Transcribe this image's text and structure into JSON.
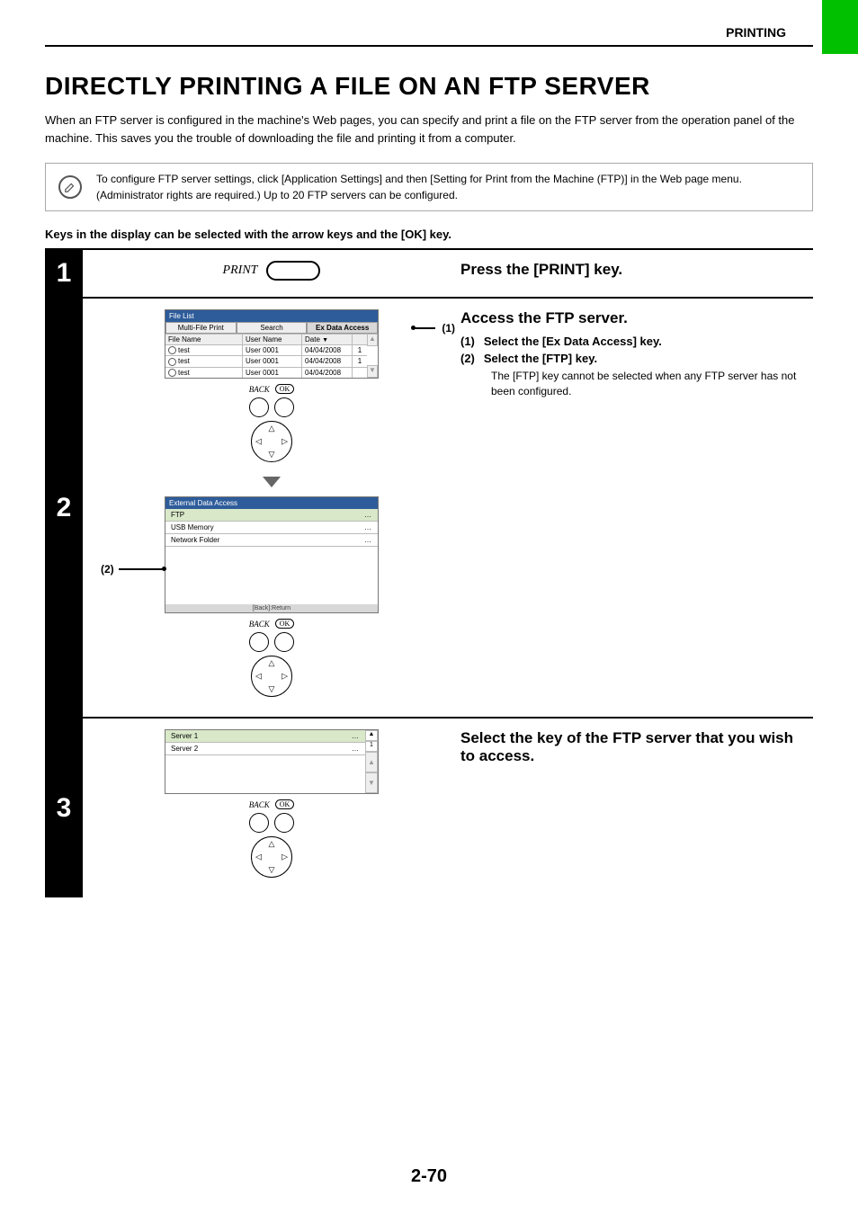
{
  "header": {
    "section": "PRINTING"
  },
  "title": "DIRECTLY PRINTING A FILE ON AN FTP SERVER",
  "intro": "When an FTP server is configured in the machine's Web pages, you can specify and print a file on the FTP server from the operation panel of the machine. This saves you the trouble of downloading the file and printing it from a computer.",
  "note": "To configure FTP server settings, click [Application Settings] and then [Setting for Print from the Machine (FTP)] in the Web page menu. (Administrator rights are required.) Up to 20 FTP servers can be configured.",
  "keys_note": "Keys in the display can be selected with the arrow keys and the [OK] key.",
  "steps": {
    "s1": {
      "num": "1",
      "print_label": "PRINT",
      "title": "Press the [PRINT] key."
    },
    "s2": {
      "num": "2",
      "title": "Access the FTP server.",
      "sub1_num": "(1)",
      "sub1_text": "Select the [Ex Data Access] key.",
      "sub2_num": "(2)",
      "sub2_text": "Select the [FTP] key.",
      "sub2_desc": "The [FTP] key cannot be selected when any FTP server has not been configured.",
      "callout1": "(1)",
      "callout2": "(2)",
      "screen1": {
        "title": "File List",
        "tab1": "Multi-File Print",
        "tab2": "Search",
        "tab3": "Ex Data Access",
        "col_fn": "File Name",
        "col_un": "User Name",
        "col_dt": "Date",
        "rows": [
          {
            "fn": "test",
            "un": "User 0001",
            "dt": "04/04/2008",
            "pg": "1"
          },
          {
            "fn": "test",
            "un": "User 0001",
            "dt": "04/04/2008",
            "pg": "1"
          },
          {
            "fn": "test",
            "un": "User 0001",
            "dt": "04/04/2008",
            "pg": ""
          }
        ]
      },
      "nav": {
        "back": "BACK",
        "ok": "OK"
      },
      "screen2": {
        "title": "External Data Access",
        "item1": "FTP",
        "item2": "USB Memory",
        "item3": "Network Folder",
        "footer": "[Back]:Return"
      }
    },
    "s3": {
      "num": "3",
      "title": "Select the key of the FTP server that you wish to access.",
      "screen": {
        "item1": "Server 1",
        "item2": "Server 2",
        "pg": "1"
      },
      "nav": {
        "back": "BACK",
        "ok": "OK"
      }
    }
  },
  "page_num": "2-70"
}
